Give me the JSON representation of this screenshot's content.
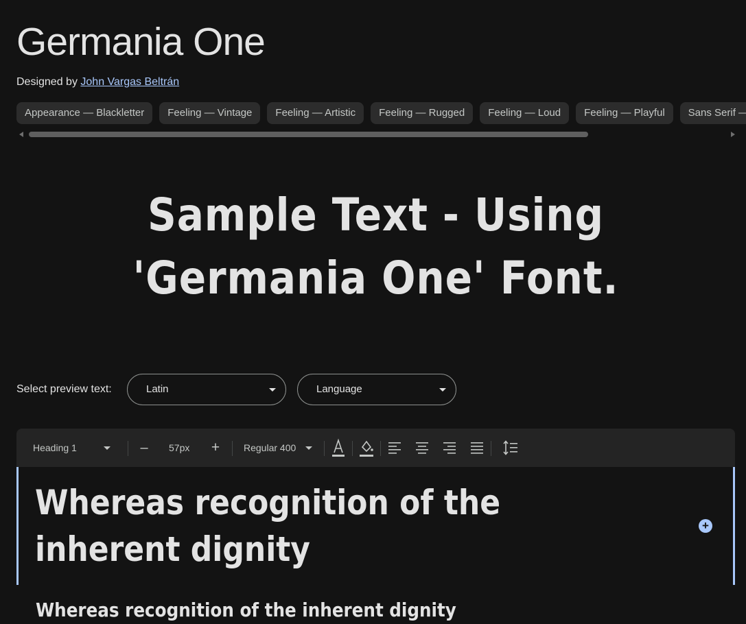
{
  "header": {
    "title": "Germania One",
    "designed_by_prefix": "Designed by ",
    "designer_name": "John Vargas Beltrán"
  },
  "tags": [
    "Appearance — Blackletter",
    "Feeling — Vintage",
    "Feeling — Artistic",
    "Feeling — Rugged",
    "Feeling — Loud",
    "Feeling — Playful",
    "Sans Serif —"
  ],
  "sample_text": "Sample Text - Using 'Germania One' Font.",
  "preview": {
    "label": "Select preview text:",
    "script_value": "Latin",
    "language_placeholder": "Language"
  },
  "toolbar": {
    "style_value": "Heading 1",
    "decrease_label": "–",
    "size_value": "57px",
    "increase_label": "+",
    "weight_value": "Regular 400"
  },
  "editor": {
    "heading_text": "Whereas recognition of the inherent dignity",
    "next_line_text": "Whereas recognition of the inherent dignity",
    "add_label": "+"
  },
  "colors": {
    "background": "#131313",
    "text": "#e3e3e3",
    "link": "#a8c7fa",
    "chip_bg": "#2c2c2c",
    "toolbar_bg": "#242424",
    "accent": "#a8c7fa"
  }
}
